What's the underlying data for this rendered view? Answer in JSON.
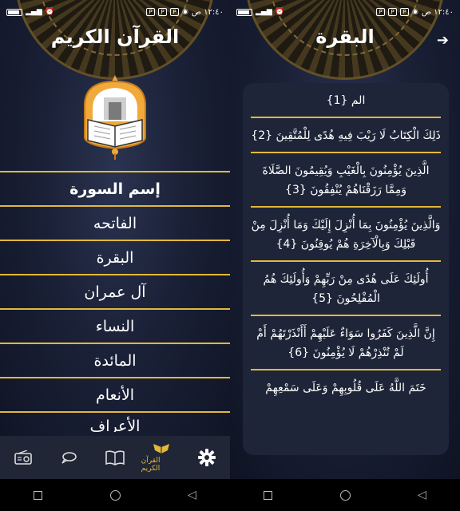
{
  "status_bar": {
    "time": "١٢:٤٠ ص",
    "left_icon": "⏰"
  },
  "left": {
    "title": "القرآن الكريم",
    "surah_header": "إسم السورة",
    "surahs": [
      "الفاتحه",
      "البقرة",
      "آل عمران",
      "النساء",
      "المائدة",
      "الأنعام",
      "الأعراف"
    ],
    "nav": {
      "quran_label": "القرآن الكريم"
    }
  },
  "right": {
    "title": "البقرة",
    "verses": [
      "الم {1}",
      "ذَلِكَ الْكِتَابُ لَا رَيْبَ فِيهِ هُدًى لِلْمُتَّقِينَ {2}",
      "الَّذِينَ يُؤْمِنُونَ بِالْغَيْبِ وَيُقِيمُونَ الصَّلَاةَ وَمِمَّا رَزَقْنَاهُمْ يُنْفِقُونَ {3}",
      "وَالَّذِينَ يُؤْمِنُونَ بِمَا أُنْزِلَ إِلَيْكَ وَمَا أُنْزِلَ مِنْ قَبْلِكَ وَبِالْآخِرَةِ هُمْ يُوقِنُونَ {4}",
      "أُولَئِكَ عَلَى هُدًى مِنْ رَبِّهِمْ وَأُولَئِكَ هُمُ الْمُفْلِحُونَ {5}",
      "إِنَّ الَّذِينَ كَفَرُوا سَوَاءٌ عَلَيْهِمْ أَأَنْذَرْتَهُمْ أَمْ لَمْ تُنْذِرْهُمْ لَا يُؤْمِنُونَ {6}",
      "خَتَمَ اللَّهُ عَلَى قُلُوبِهِمْ وَعَلَى سَمْعِهِمْ"
    ]
  },
  "colors": {
    "accent": "#e2b83c",
    "background": "#1a2036",
    "card": "#1e2538"
  },
  "icons": [
    "gear-icon",
    "quran-icon",
    "book-icon",
    "chat-icon",
    "radio-icon",
    "back-arrow-icon"
  ]
}
